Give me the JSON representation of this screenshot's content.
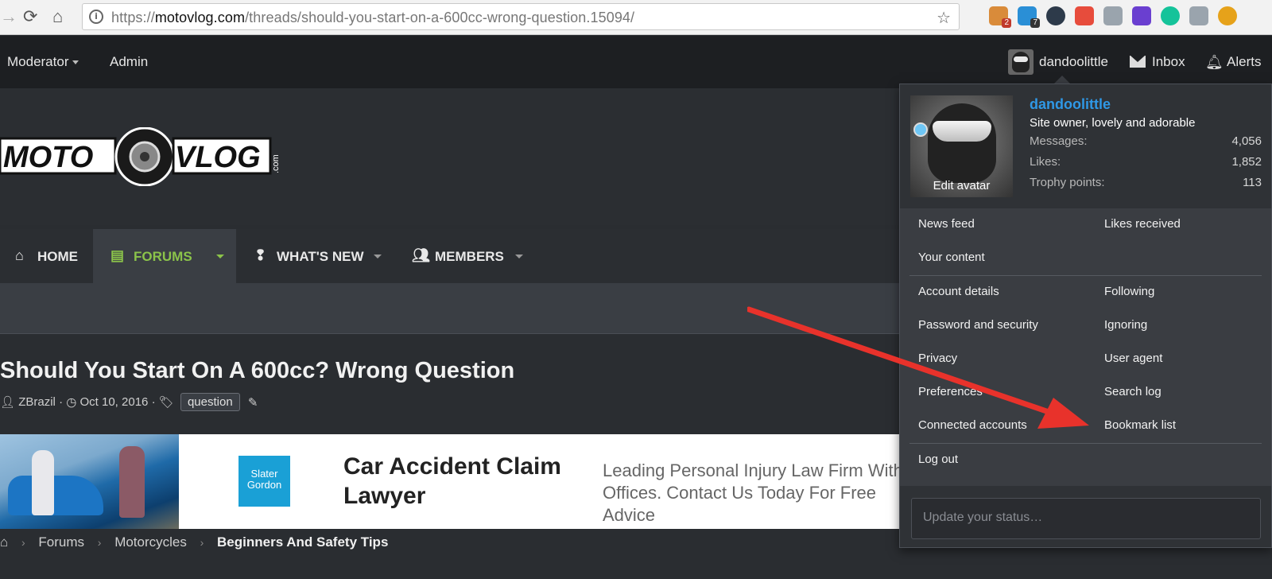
{
  "browser": {
    "url_host": "motovlog.com",
    "url_prefix": "https://",
    "url_path": "/threads/should-you-start-on-a-600cc-wrong-question.15094/",
    "extensions": [
      {
        "name": "cookie-ext",
        "badge": "2",
        "color": "#d98b3a"
      },
      {
        "name": "hub-ext",
        "badge": "7",
        "color": "#2a8fd6"
      },
      {
        "name": "k-ext",
        "badge": "",
        "color": "#2d3a4a"
      },
      {
        "name": "star-ext",
        "badge": "",
        "color": "#e74c3c"
      },
      {
        "name": "mail-ext",
        "badge": "",
        "color": "#9aa4ad"
      },
      {
        "name": "gem-ext",
        "badge": "",
        "color": "#6a3fd0"
      },
      {
        "name": "grammarly-ext",
        "badge": "",
        "color": "#15c39a"
      },
      {
        "name": "inbox-ext",
        "badge": "",
        "color": "#9aa4ad"
      },
      {
        "name": "sun-ext",
        "badge": "",
        "color": "#e6a21a"
      }
    ]
  },
  "topnav": {
    "moderator": "Moderator",
    "admin": "Admin",
    "username": "dandoolittle",
    "inbox": "Inbox",
    "alerts": "Alerts"
  },
  "logo": {
    "text_left": "MOTO",
    "text_right": "VLOG",
    "suffix": ".com"
  },
  "tabs": {
    "home": "HOME",
    "forums": "FORUMS",
    "whats_new": "WHAT'S NEW",
    "members": "MEMBERS"
  },
  "thread": {
    "title": "Should You Start On A 600cc? Wrong Question",
    "author": "ZBrazil",
    "date": "Oct 10, 2016",
    "tag": "question"
  },
  "ad": {
    "logo_line1": "Slater",
    "logo_line2": "Gordon",
    "headline": "Car Accident Claim Lawyer",
    "body": "Leading Personal Injury Law Firm With Offices. Contact Us Today For Free Advice"
  },
  "breadcrumb": {
    "items": [
      "Forums",
      "Motorcycles"
    ],
    "current": "Beginners And Safety Tips"
  },
  "dropdown": {
    "username": "dandoolittle",
    "user_title": "Site owner, lovely and adorable",
    "edit_avatar": "Edit avatar",
    "stats": [
      {
        "label": "Messages:",
        "value": "4,056"
      },
      {
        "label": "Likes:",
        "value": "1,852"
      },
      {
        "label": "Trophy points:",
        "value": "113"
      }
    ],
    "links_a": {
      "news_feed": "News feed",
      "likes_received": "Likes received",
      "your_content": "Your content"
    },
    "links_b": {
      "account_details": "Account details",
      "following": "Following",
      "password_security": "Password and security",
      "ignoring": "Ignoring",
      "privacy": "Privacy",
      "user_agent": "User agent",
      "preferences": "Preferences",
      "search_log": "Search log",
      "connected_accounts": "Connected accounts",
      "bookmark_list": "Bookmark list"
    },
    "log_out": "Log out",
    "status_placeholder": "Update your status…"
  },
  "annotation": {
    "arrow_color": "#e8322b"
  }
}
